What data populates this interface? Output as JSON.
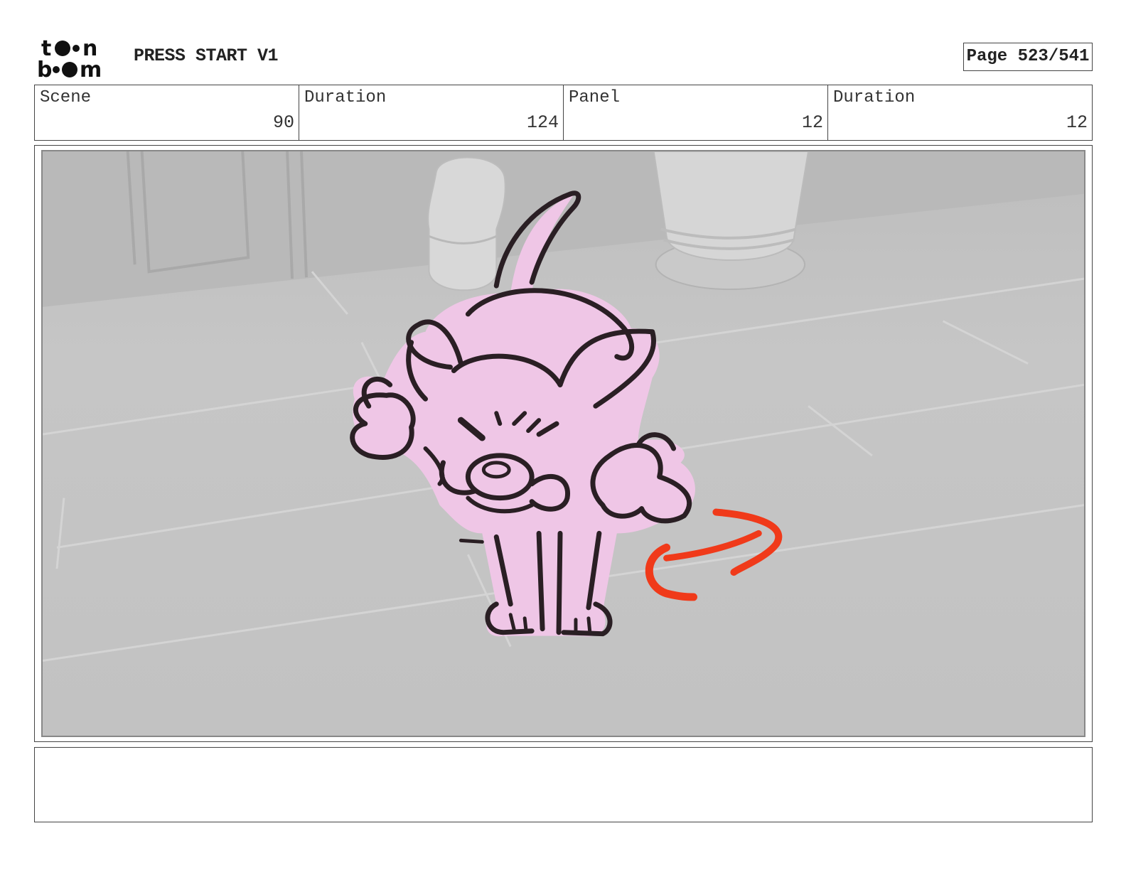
{
  "header": {
    "logo_text": "toon boom",
    "project_title": "PRESS START V1",
    "page_label": "Page 523/541"
  },
  "info": [
    {
      "label": "Scene",
      "value": "90"
    },
    {
      "label": "Duration",
      "value": "124"
    },
    {
      "label": "Panel",
      "value": "12"
    },
    {
      "label": "Duration",
      "value": "12"
    }
  ],
  "panel": {
    "description": "",
    "colors": {
      "background": "#c4c4c4",
      "character_fill": "#efc6e6",
      "line": "#2a1f24",
      "motion_arrow": "#f03a1a"
    }
  },
  "notes": {
    "text": ""
  }
}
